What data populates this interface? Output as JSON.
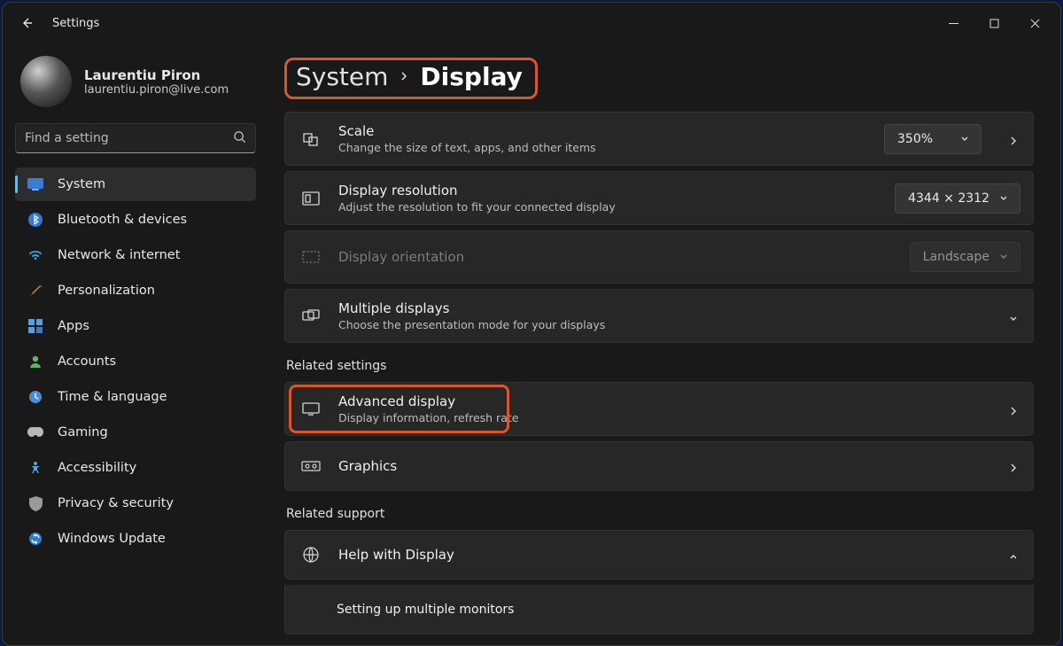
{
  "window": {
    "title": "Settings"
  },
  "user": {
    "name": "Laurentiu Piron",
    "email": "laurentiu.piron@live.com"
  },
  "search": {
    "placeholder": "Find a setting"
  },
  "nav": {
    "items": [
      {
        "label": "System"
      },
      {
        "label": "Bluetooth & devices"
      },
      {
        "label": "Network & internet"
      },
      {
        "label": "Personalization"
      },
      {
        "label": "Apps"
      },
      {
        "label": "Accounts"
      },
      {
        "label": "Time & language"
      },
      {
        "label": "Gaming"
      },
      {
        "label": "Accessibility"
      },
      {
        "label": "Privacy & security"
      },
      {
        "label": "Windows Update"
      }
    ]
  },
  "breadcrumb": {
    "parent": "System",
    "current": "Display"
  },
  "cards": {
    "scale": {
      "title": "Scale",
      "desc": "Change the size of text, apps, and other items",
      "value": "350%"
    },
    "resolution": {
      "title": "Display resolution",
      "desc": "Adjust the resolution to fit your connected display",
      "value": "4344 × 2312"
    },
    "orientation": {
      "title": "Display orientation",
      "value": "Landscape"
    },
    "multi": {
      "title": "Multiple displays",
      "desc": "Choose the presentation mode for your displays"
    }
  },
  "related_settings": {
    "heading": "Related settings",
    "advanced": {
      "title": "Advanced display",
      "desc": "Display information, refresh rate"
    },
    "graphics": {
      "title": "Graphics"
    }
  },
  "related_support": {
    "heading": "Related support",
    "help": {
      "title": "Help with Display"
    },
    "item1": "Setting up multiple monitors"
  }
}
